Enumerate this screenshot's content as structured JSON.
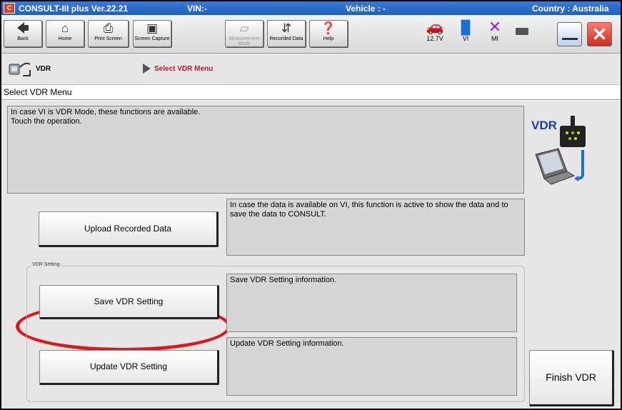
{
  "titlebar": {
    "app": "CONSULT-III plus  Ver.22.21",
    "vin": "VIN:-",
    "vehicle": "Vehicle : -",
    "country": "Country : Australia"
  },
  "toolbar": {
    "back": "Back",
    "home": "Home",
    "print_screen": "Print Screen",
    "screen_capture": "Screen Capture",
    "measurement_mode": "Measurement Mode",
    "recorded_data": "Recorded Data",
    "help": "Help",
    "battery_voltage": "12.7V",
    "vi": "VI",
    "mi": "MI"
  },
  "breadcrumb": {
    "root": "VDR",
    "current": "Select VDR Menu"
  },
  "page_title": "Select VDR Menu",
  "intro": {
    "line1": "In case VI is VDR Mode, these functions are available.",
    "line2": "Touch the operation."
  },
  "vdr_logo_text": "VDR",
  "upload": {
    "label": "Upload Recorded Data",
    "description": "In case the data is available on VI, this function is active to show the data and to save the data to CONSULT."
  },
  "vdr_setting_group": "VDR Setting",
  "save_setting": {
    "label": "Save VDR Setting",
    "description": "Save VDR Setting information."
  },
  "update_setting": {
    "label": "Update VDR Setting",
    "description": "Update VDR Setting information."
  },
  "finish_button": "Finish VDR",
  "colors": {
    "titlebar": "#2a6bcc",
    "highlight": "#e0161c",
    "breadcrumb_current": "#c0182d",
    "panel": "#e6e6e6"
  }
}
